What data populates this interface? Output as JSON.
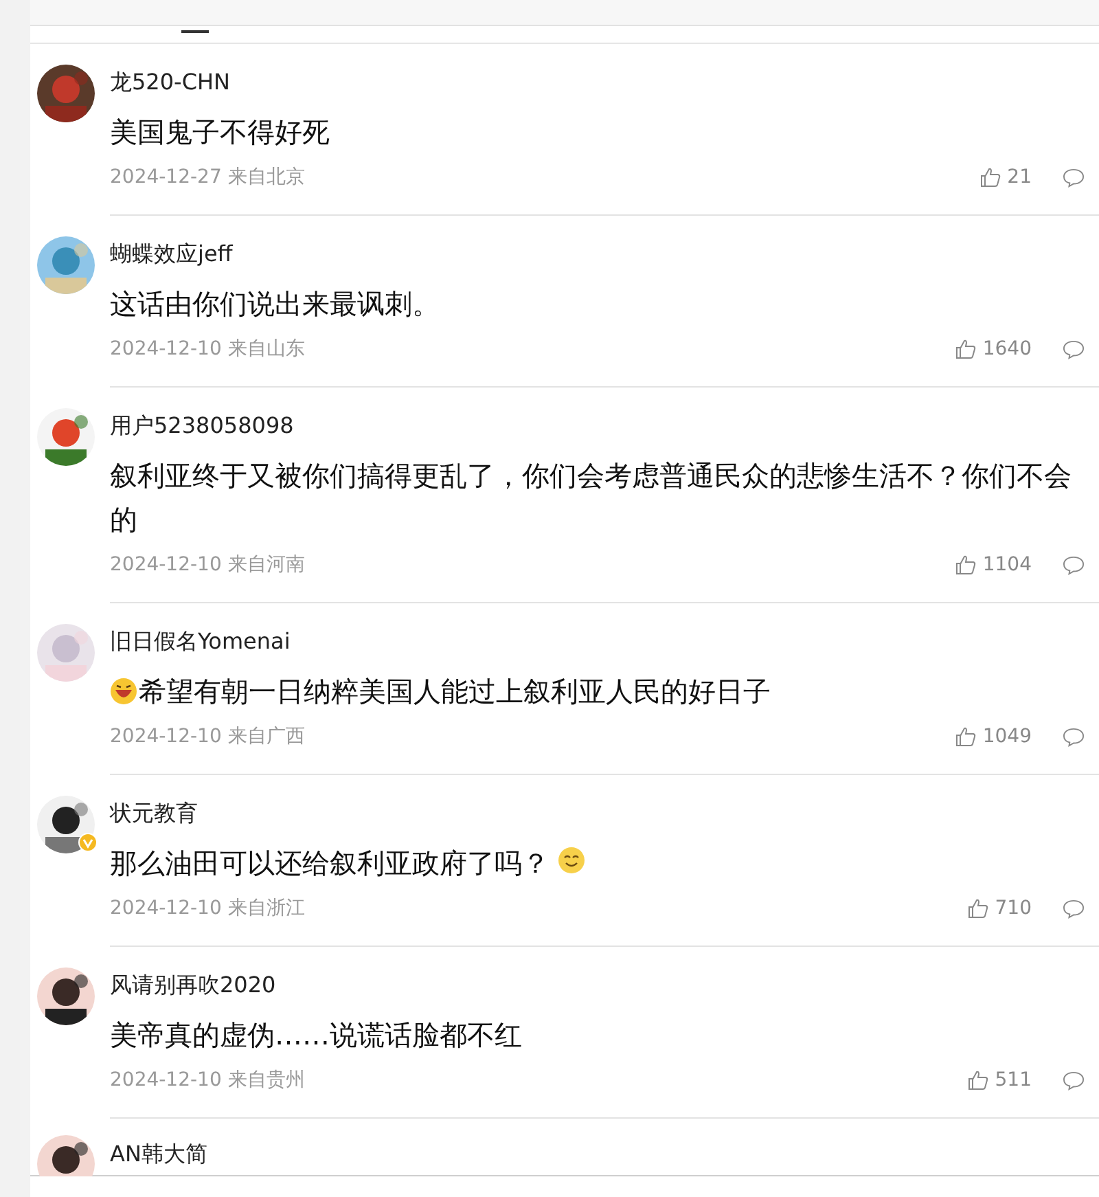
{
  "comments": [
    {
      "user": "龙520-CHN",
      "verified": false,
      "text": "美国鬼子不得好死",
      "emoji_before": false,
      "emoji_after": false,
      "date": "2024-12-27 来自北京",
      "likes": "21"
    },
    {
      "user": "蝴蝶效应jeff",
      "verified": false,
      "text": "这话由你们说出来最讽刺。",
      "emoji_before": false,
      "emoji_after": false,
      "date": "2024-12-10 来自山东",
      "likes": "1640"
    },
    {
      "user": "用户5238058098",
      "verified": false,
      "text": "叙利亚终于又被你们搞得更乱了，你们会考虑普通民众的悲惨生活不？你们不会的",
      "emoji_before": false,
      "emoji_after": false,
      "date": "2024-12-10 来自河南",
      "likes": "1104"
    },
    {
      "user": "旧日假名Yomenai",
      "verified": false,
      "text": "希望有朝一日纳粹美国人能过上叙利亚人民的好日子",
      "emoji_before": true,
      "emoji_after": false,
      "date": "2024-12-10 来自广西",
      "likes": "1049"
    },
    {
      "user": "状元教育",
      "verified": true,
      "text": "那么油田可以还给叙利亚政府了吗？",
      "emoji_before": false,
      "emoji_after": true,
      "date": "2024-12-10 来自浙江",
      "likes": "710"
    },
    {
      "user": "风请别再吹2020",
      "verified": false,
      "text": "美帝真的虚伪……说谎话脸都不红",
      "emoji_before": false,
      "emoji_after": false,
      "date": "2024-12-10 来自贵州",
      "likes": "511"
    }
  ],
  "partial_comment": {
    "user": "AN韩大简"
  }
}
